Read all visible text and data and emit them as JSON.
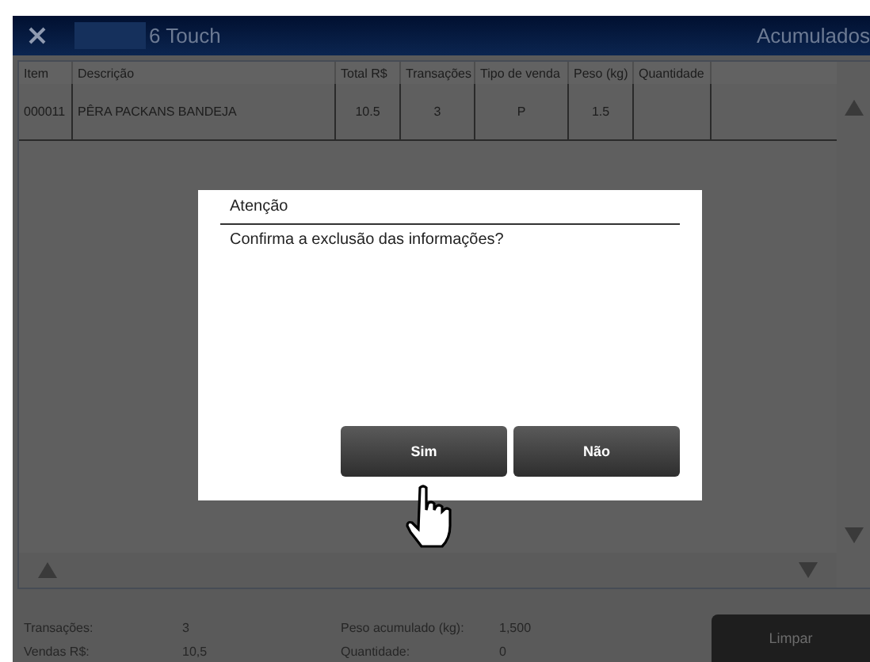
{
  "window": {
    "title": "6 Touch",
    "section": "Acumulados"
  },
  "table": {
    "columns": [
      "Item",
      "Descrição",
      "Total  R$",
      "Transações",
      "Tipo de venda",
      "Peso (kg)",
      "Quantidade"
    ],
    "rows": [
      {
        "cells": [
          "000011",
          "PÊRA PACKANS BANDEJA",
          "10.5",
          "3",
          "P",
          "1.5",
          ""
        ]
      }
    ]
  },
  "dialog": {
    "title": "Atenção",
    "message": "Confirma a exclusão das informações?",
    "buttons": [
      "Sim",
      "Não"
    ]
  },
  "summary": [
    {
      "label": "Transações:",
      "value": "3"
    },
    {
      "label": "Peso acumulado (kg):",
      "value": "1,500"
    },
    {
      "label": "Vendas  R$:",
      "value": "10,5"
    },
    {
      "label": "Quantidade:",
      "value": "0"
    }
  ],
  "clear_button": "Limpar"
}
